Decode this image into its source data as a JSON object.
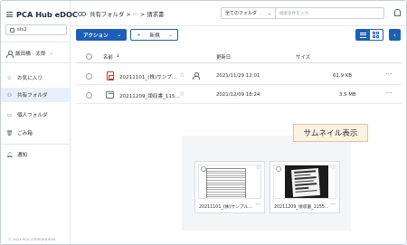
{
  "app": {
    "title": "PCA Hub eDOC",
    "tenant": "sls2",
    "user": "飯田橋　太郎",
    "copyright": "© 2021 PCA CORPORATION"
  },
  "nav": {
    "items": [
      {
        "label": "お気に入り",
        "icon": "star-icon"
      },
      {
        "label": "共有フォルダ",
        "icon": "shared-folder-icon",
        "active": true
      },
      {
        "label": "個人フォルダ",
        "icon": "folder-icon"
      },
      {
        "label": "ごみ箱",
        "icon": "trash-icon"
      },
      {
        "label": "通知",
        "icon": "bell-icon"
      }
    ]
  },
  "header": {
    "breadcrumb": "共有フォルダ > ··· > 請求書",
    "search_scope": "全てのフォルダ",
    "search_placeholder": "検索条件を入力"
  },
  "toolbar": {
    "action_label": "アクション",
    "new_label": "新規",
    "new_prefix": "+"
  },
  "table": {
    "columns": {
      "name": "名前",
      "sort": "↓",
      "updated": "更新日",
      "size": "サイズ"
    },
    "rows": [
      {
        "name": "20211101_(株)サンプ...",
        "updated": "2021/11/29 12:01",
        "size": "61.9 KB",
        "type": "pdf"
      },
      {
        "name": "20211209_領収書_115...",
        "updated": "2021/12/09 18:24",
        "size": "3.5 MB",
        "type": "image"
      }
    ]
  },
  "thumbnail": {
    "label": "サムネイル表示",
    "cards": [
      {
        "name": "20211101_(株)サンプル..."
      },
      {
        "name": "20211209_領収書_1155..."
      }
    ]
  },
  "colors": {
    "accent": "#1d5fb6",
    "active_nav": "#e9effa",
    "callout_bg": "#fdf1e2"
  }
}
